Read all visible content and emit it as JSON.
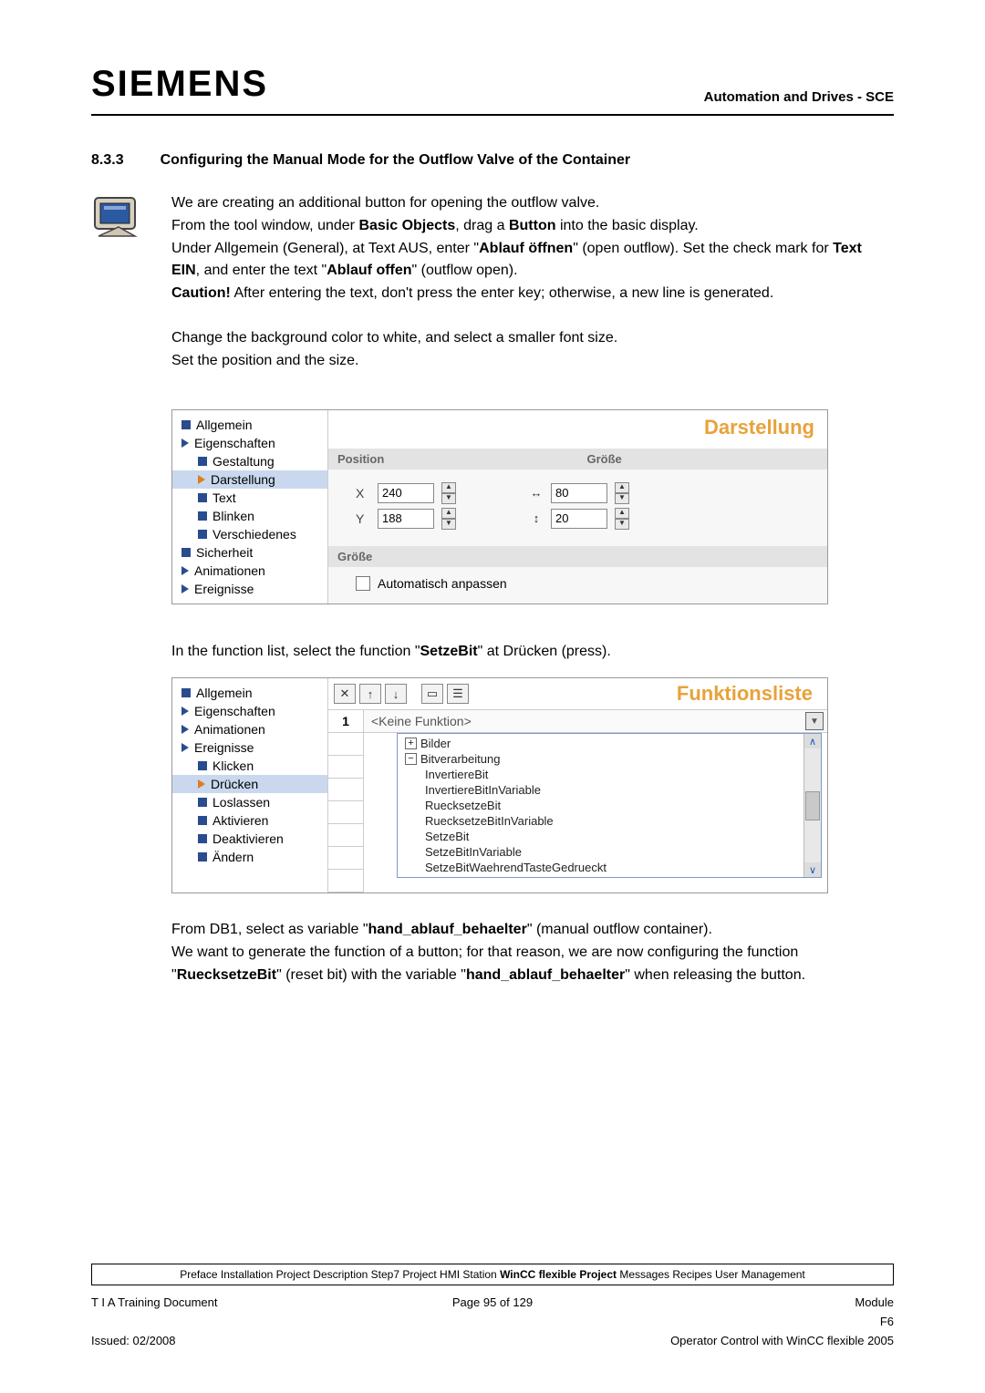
{
  "header": {
    "logo": "SIEMENS",
    "right": "Automation and Drives - SCE"
  },
  "section": {
    "num": "8.3.3",
    "title": "Configuring the Manual Mode for the Outflow Valve of the Container"
  },
  "para1": {
    "l1": "We are creating an additional button for opening the outflow valve.",
    "l2a": "From the tool window, under ",
    "l2b": "Basic Objects",
    "l2c": ", drag a ",
    "l2d": "Button",
    "l2e": " into the basic display.",
    "l3a": "Under Allgemein (General), at Text  AUS, enter \"",
    "l3b": "Ablauf öffnen",
    "l3c": "\" (open outflow). Set the check mark for ",
    "l3d": "Text EIN",
    "l3e": ", and enter the text \"",
    "l3f": "Ablauf offen",
    "l3g": "\" (outflow open).",
    "l4a": "Caution!",
    "l4b": " After entering the text, don't press the enter key; otherwise, a new line is generated."
  },
  "para2": {
    "l1": "Change the background color to white, and select a smaller font size.",
    "l2": "Set the position and the size."
  },
  "panel1": {
    "title": "Darstellung",
    "tree": {
      "allgemein": "Allgemein",
      "eigenschaften": "Eigenschaften",
      "gestaltung": "Gestaltung",
      "darstellung": "Darstellung",
      "text": "Text",
      "blinken": "Blinken",
      "verschiedenes": "Verschiedenes",
      "sicherheit": "Sicherheit",
      "animationen": "Animationen",
      "ereignisse": "Ereignisse"
    },
    "groups": {
      "position": "Position",
      "groesse": "Größe",
      "groesse2": "Größe"
    },
    "fields": {
      "xLabel": "X",
      "xVal": "240",
      "yLabel": "Y",
      "yVal": "188",
      "wVal": "80",
      "hVal": "20"
    },
    "chk": "Automatisch anpassen"
  },
  "mid": {
    "l1a": "In the function list, select the function \"",
    "l1b": "SetzeBit",
    "l1c": "\" at Drücken (press)."
  },
  "panel2": {
    "title": "Funktionsliste",
    "tree": {
      "allgemein": "Allgemein",
      "eigenschaften": "Eigenschaften",
      "animationen": "Animationen",
      "ereignisse": "Ereignisse",
      "klicken": "Klicken",
      "druecken": "Drücken",
      "loslassen": "Loslassen",
      "aktivieren": "Aktivieren",
      "deaktivieren": "Deaktivieren",
      "aendern": "Ändern"
    },
    "rownum": "1",
    "dropdown": "<Keine Funktion>",
    "list": {
      "bilder": "Bilder",
      "bitverarbeitung": "Bitverarbeitung",
      "i1": "InvertiereBit",
      "i2": "InvertiereBitInVariable",
      "i3": "RuecksetzeBit",
      "i4": "RuecksetzeBitInVariable",
      "i5": "SetzeBit",
      "i6": "SetzeBitInVariable",
      "i7": "SetzeBitWaehrendTasteGedrueckt"
    }
  },
  "para3": {
    "l1a": "From DB1, select as variable \"",
    "l1b": "hand_ablauf_behaelter",
    "l1c": "\" (manual outflow container).",
    "l2a": "We want to generate the function of a button; for that reason, we are now configuring the function \"",
    "l2b": "RuecksetzeBit",
    "l2c": "\" (reset bit) with the variable \"",
    "l2d": "hand_ablauf_behaelter",
    "l2e": "\" when releasing the button."
  },
  "nav": {
    "pre": "Preface Installation Project Description Step7 Project HMI Station ",
    "cur": "WinCC flexible Project",
    "post": " Messages Recipes User Management"
  },
  "footer": {
    "l1": "T I A  Training Document",
    "c1": "Page 95 of 129",
    "r1": "Module",
    "r2": "F6",
    "l2": "Issued: 02/2008",
    "r3": "Operator Control with WinCC flexible 2005"
  }
}
